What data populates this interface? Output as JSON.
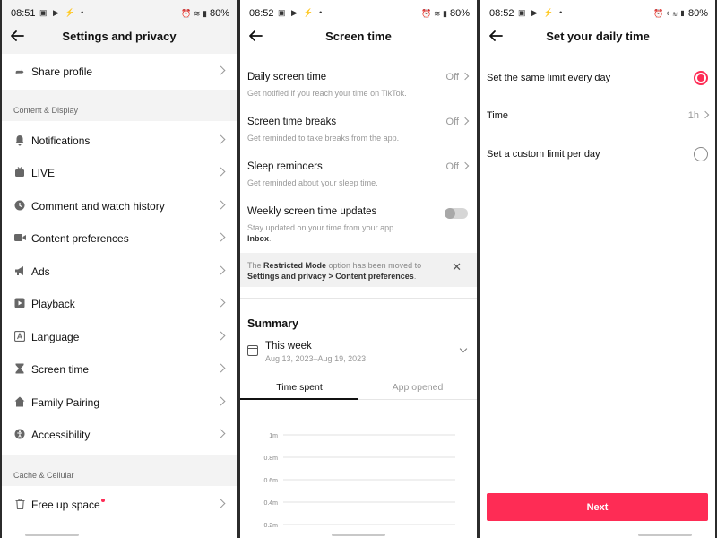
{
  "panel1": {
    "status": {
      "time": "08:51",
      "icons": "▣ ▶ ⚡ •",
      "right_icons": "⏰ ≋ ▮",
      "battery": "80%"
    },
    "title": "Settings and privacy",
    "share": {
      "label": "Share profile",
      "icon": "share-arrow-icon"
    },
    "section_content": "Content & Display",
    "items": [
      {
        "label": "Notifications",
        "icon": "bell-icon"
      },
      {
        "label": "LIVE",
        "icon": "live-tv-icon"
      },
      {
        "label": "Comment and watch history",
        "icon": "clock-icon"
      },
      {
        "label": "Content preferences",
        "icon": "video-camera-icon"
      },
      {
        "label": "Ads",
        "icon": "megaphone-icon"
      },
      {
        "label": "Playback",
        "icon": "play-square-icon"
      },
      {
        "label": "Language",
        "icon": "language-a-icon"
      },
      {
        "label": "Screen time",
        "icon": "hourglass-icon"
      },
      {
        "label": "Family Pairing",
        "icon": "home-heart-icon"
      },
      {
        "label": "Accessibility",
        "icon": "accessibility-icon"
      }
    ],
    "section_cache": "Cache & Cellular",
    "free_space": {
      "label": "Free up space",
      "icon": "trash-icon"
    }
  },
  "panel2": {
    "status": {
      "time": "08:52",
      "icons": "▣ ▶ ⚡ •",
      "right_icons": "⏰ ≋ ▮",
      "battery": "80%"
    },
    "title": "Screen time",
    "rows": [
      {
        "title": "Daily screen time",
        "sub": "Get notified if you reach your time on TikTok.",
        "value": "Off"
      },
      {
        "title": "Screen time breaks",
        "sub": "Get reminded to take breaks from the app.",
        "value": "Off"
      },
      {
        "title": "Sleep reminders",
        "sub": "Get reminded about your sleep time.",
        "value": "Off"
      }
    ],
    "weekly": {
      "title": "Weekly screen time updates",
      "sub": "Stay updated on your time from your app",
      "sub_bold": "Inbox",
      "sub_end": "."
    },
    "notice": {
      "pre": "The ",
      "bold1": "Restricted Mode",
      "mid": " option has been moved to ",
      "bold2": "Settings and privacy > Content preferences",
      "end": "."
    },
    "summary_title": "Summary",
    "week": {
      "title": "This week",
      "range": "Aug 13, 2023–Aug 19, 2023"
    },
    "tabs": {
      "active": "Time spent",
      "inactive": "App opened"
    }
  },
  "panel3": {
    "status": {
      "time": "08:52",
      "icons": "▣ ▶ ⚡ •",
      "right_icons": "⏰ ⌖ ≋ ▮",
      "battery": "80%"
    },
    "title": "Set your daily time",
    "option_same": "Set the same limit every day",
    "time_label": "Time",
    "time_value": "1h",
    "option_custom": "Set a custom limit per day",
    "next_label": "Next"
  },
  "colors": {
    "accent": "#fe2c55",
    "notice_bg": "#f1f1f1",
    "page_bg": "#f3f3f3"
  },
  "chart_data": {
    "type": "bar",
    "categories": [],
    "values": [],
    "yticks": [
      "1m",
      "0.8m",
      "0.6m",
      "0.4m",
      "0.2m"
    ],
    "ylim": [
      0,
      1
    ],
    "grid": true
  }
}
